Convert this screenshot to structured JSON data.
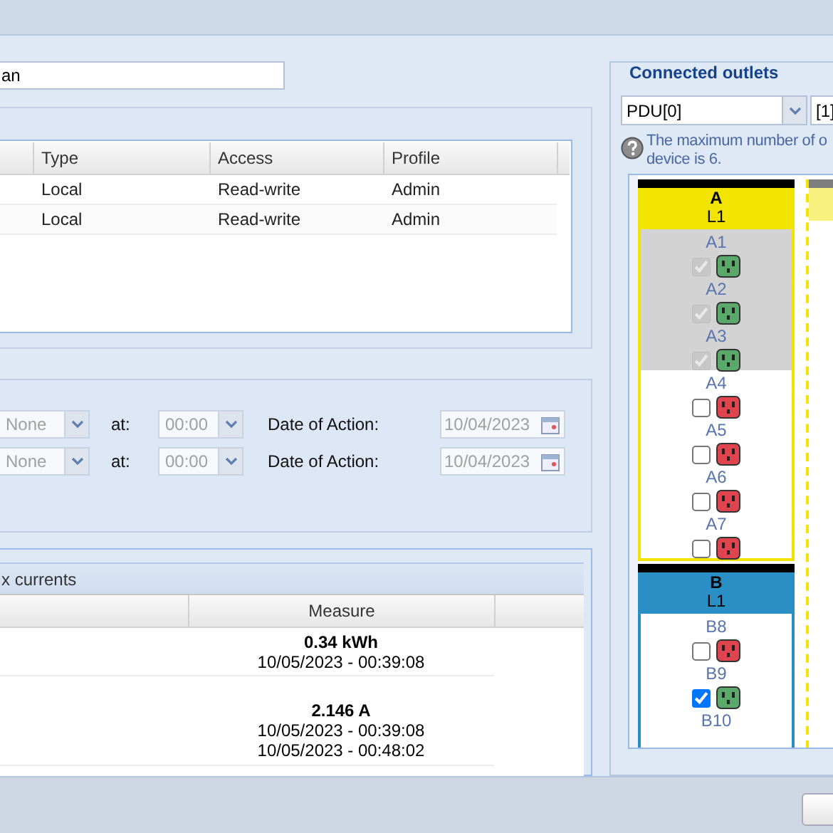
{
  "name_field": {
    "value": "an"
  },
  "users_table": {
    "columns": [
      "Type",
      "Access",
      "Profile"
    ],
    "rows": [
      {
        "type": "Local",
        "access": "Read-write",
        "profile": "Admin"
      },
      {
        "type": "Local",
        "access": "Read-write",
        "profile": "Admin"
      }
    ]
  },
  "schedule": [
    {
      "action": "None",
      "at_label": "at:",
      "time": "00:00",
      "date_label": "Date of Action:",
      "date": "10/04/2023",
      "disabled": true
    },
    {
      "action": "None",
      "at_label": "at:",
      "time": "00:00",
      "date_label": "Date of Action:",
      "date": "10/04/2023",
      "disabled": true
    }
  ],
  "measures": {
    "title": "x currents",
    "columns": [
      "Measure"
    ],
    "rows": [
      {
        "value": "0.34 kWh",
        "times": [
          "10/05/2023 - 00:39:08"
        ]
      },
      {
        "value": "2.146 A",
        "times": [
          "10/05/2023 - 00:39:08",
          "10/05/2023 - 00:48:02"
        ]
      }
    ]
  },
  "outlets": {
    "legend": "Connected outlets",
    "pdu": "PDU[0]",
    "index": "[1]",
    "help": [
      "The maximum number of o",
      "device is 6."
    ],
    "groups": [
      {
        "name": "A",
        "phase": "L1",
        "color": "#f2e400",
        "outlets": [
          {
            "label": "A1",
            "checked": true,
            "disabled": true,
            "powered": true
          },
          {
            "label": "A2",
            "checked": true,
            "disabled": true,
            "powered": true
          },
          {
            "label": "A3",
            "checked": true,
            "disabled": true,
            "powered": true
          },
          {
            "label": "A4",
            "checked": false,
            "disabled": false,
            "powered": false
          },
          {
            "label": "A5",
            "checked": false,
            "disabled": false,
            "powered": false
          },
          {
            "label": "A6",
            "checked": false,
            "disabled": false,
            "powered": false
          },
          {
            "label": "A7",
            "checked": false,
            "disabled": false,
            "powered": false
          }
        ]
      },
      {
        "name": "B",
        "phase": "L1",
        "color": "#2a8fc4",
        "outlets": [
          {
            "label": "B8",
            "checked": false,
            "disabled": false,
            "powered": false
          },
          {
            "label": "B9",
            "checked": true,
            "disabled": false,
            "powered": true
          },
          {
            "label": "B10"
          }
        ]
      }
    ],
    "next_group": {
      "color": "#f2e400"
    }
  }
}
